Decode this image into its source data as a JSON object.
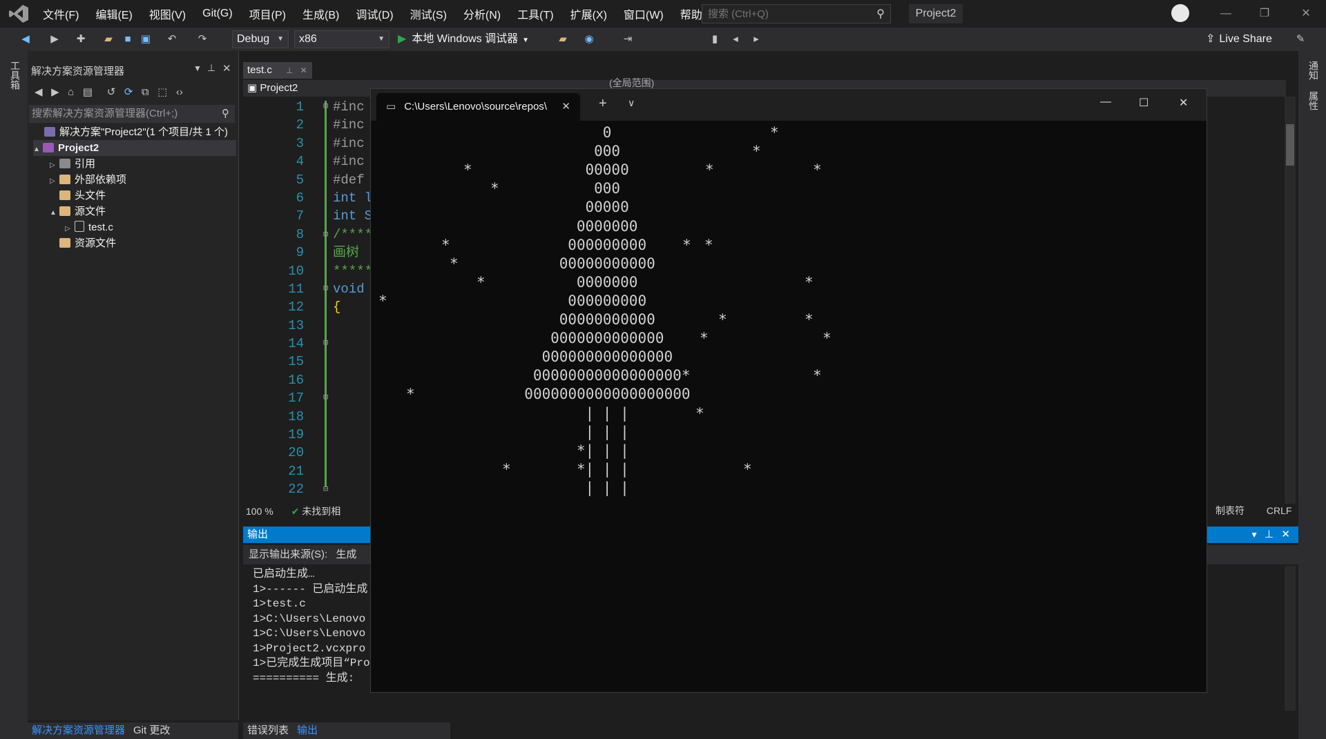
{
  "titlebar": {
    "menu": [
      "文件(F)",
      "编辑(E)",
      "视图(V)",
      "Git(G)",
      "项目(P)",
      "生成(B)",
      "调试(D)",
      "测试(S)",
      "分析(N)",
      "工具(T)",
      "扩展(X)",
      "窗口(W)",
      "帮助(H)"
    ],
    "search_placeholder": "搜索 (Ctrl+Q)",
    "project_name": "Project2"
  },
  "toolbar": {
    "config": "Debug",
    "platform": "x86",
    "run_label": "本地 Windows 调试器",
    "live_share": "Live Share"
  },
  "left_strip": {
    "toolbox": "工具箱"
  },
  "right_strip": {
    "notifications": "通知",
    "properties": "属性"
  },
  "solution_explorer": {
    "title": "解决方案资源管理器",
    "search_placeholder": "搜索解决方案资源管理器(Ctrl+;)",
    "tree": [
      {
        "label": "解决方案\"Project2\"(1 个项目/共 1 个)",
        "level": 0,
        "expander": "",
        "icon": "solution-icon"
      },
      {
        "label": "Project2",
        "level": 0,
        "expander": "▲",
        "icon": "project-icon"
      },
      {
        "label": "引用",
        "level": 1,
        "expander": "▷",
        "icon": "references-icon"
      },
      {
        "label": "外部依赖项",
        "level": 1,
        "expander": "▷",
        "icon": "folder-icon"
      },
      {
        "label": "头文件",
        "level": 1,
        "expander": "",
        "icon": "folder-icon"
      },
      {
        "label": "源文件",
        "level": 1,
        "expander": "▲",
        "icon": "folder-icon"
      },
      {
        "label": "test.c",
        "level": 2,
        "expander": "▷",
        "icon": "c-file-icon"
      },
      {
        "label": "资源文件",
        "level": 1,
        "expander": "",
        "icon": "folder-icon"
      }
    ],
    "bottom_tabs": [
      "解决方案资源管理器",
      "Git 更改"
    ]
  },
  "editor": {
    "tab": "test.c",
    "nav_project": "Project2",
    "nav_scope": "(全局范围)",
    "line_numbers": [
      "1",
      "2",
      "3",
      "4",
      "5",
      "6",
      "7",
      "8",
      "9",
      "10",
      "11",
      "12",
      "13",
      "14",
      "15",
      "16",
      "17",
      "18",
      "19",
      "20",
      "21",
      "22"
    ],
    "lines": [
      "#inc",
      "#inc",
      "#inc",
      "#inc",
      "#def",
      "int l",
      "int S",
      "/****",
      "画树",
      "*****",
      "void",
      "{",
      "",
      "",
      "",
      "",
      "",
      "",
      "",
      "",
      "",
      ""
    ],
    "zoom": "100 %",
    "status_issue": "未找到相",
    "status_tabs": "制表符",
    "status_eol": "CRLF"
  },
  "output": {
    "title": "输出",
    "source_label": "显示输出来源(S):",
    "source_value": "生成",
    "lines": [
      "已启动生成…",
      "1>------ 已启动生成",
      "1>test.c",
      "1>C:\\Users\\Lenovo",
      "1>C:\\Users\\Lenovo",
      "1>Project2.vcxpro",
      "1>已完成生成项目“Pro",
      "========== 生成: "
    ],
    "bottom_tabs": [
      "错误列表",
      "输出"
    ]
  },
  "terminal": {
    "tab_title": "C:\\Users\\Lenovo\\source\\repos\\",
    "tree_rows": [
      "0",
      "000",
      "00000",
      "000",
      "00000",
      "0000000",
      "000000000",
      "00000000000",
      "0000000",
      "000000000",
      "00000000000",
      "0000000000000",
      "000000000000000",
      "00000000000000000*",
      "0000000000000000000",
      "| | |",
      "| | |",
      "*| | |",
      "*| | |",
      "| | |"
    ],
    "stars": "*"
  },
  "colors": {
    "accent": "#007acc",
    "run_green": "#2ca84b",
    "line_numbers": "#2b91af",
    "keyword": "#569cd6",
    "preprocessor": "#9b9b9b",
    "comment": "#57a64a"
  }
}
